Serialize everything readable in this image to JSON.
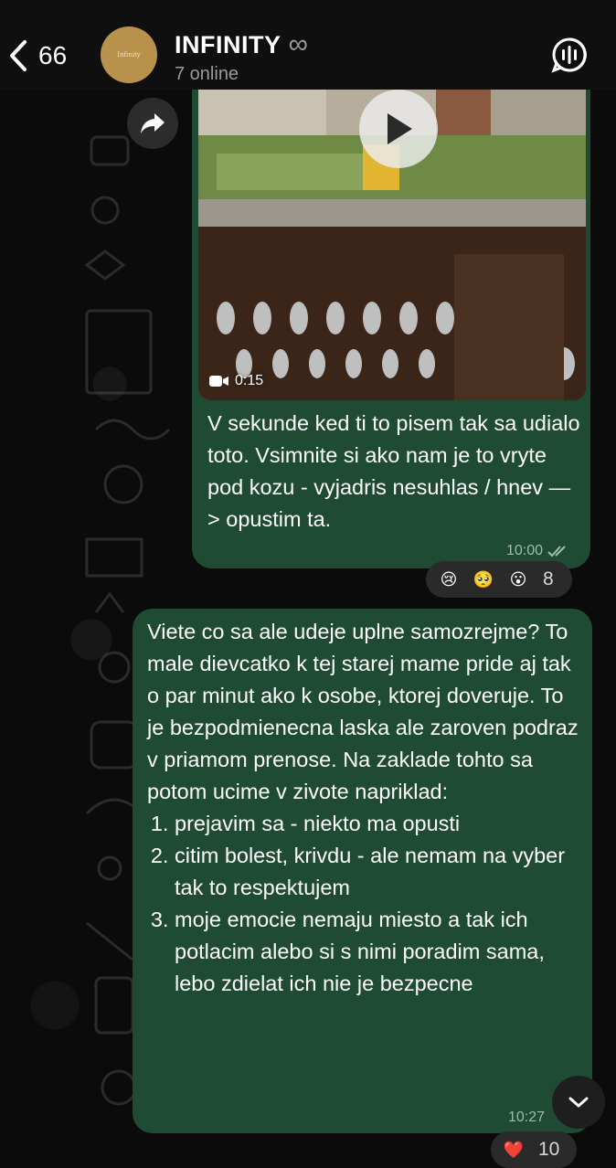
{
  "header": {
    "back_count": "66",
    "avatar_text": "Infinity",
    "title": "INFINITY",
    "title_symbol": "∞",
    "subtitle": "7 online",
    "call_icon": "voice-chat-icon"
  },
  "messages": [
    {
      "type": "video",
      "video_duration": "0:15",
      "text": "V sekunde ked ti to pisem tak sa udialo toto. Vsimnite si ako nam je to vryte pod kozu - vyjadris nesuhlas / hnev —> opustim ta.",
      "time": "10:00",
      "status": "read",
      "reactions": [
        "😢",
        "🥺",
        "😮"
      ],
      "reaction_count": "8"
    },
    {
      "type": "text",
      "intro": "Viete co sa ale udeje uplne samozrejme? To male dievcatko k tej starej mame pride aj tak o par minut ako k osobe, ktorej doveruje. To je bezpodmienecna laska ale zaroven podraz v priamom prenose. Na zaklade tohto sa potom ucime v zivote napriklad:",
      "items": [
        "prejavim sa - niekto ma opusti",
        "citim bolest, krivdu - ale nemam na vyber tak to respektujem",
        "moje emocie nemaju miesto a tak ich potlacim alebo si s nimi poradim sama, lebo zdielat ich nie je bezpecne"
      ],
      "time": "10:27",
      "reactions": [
        "❤️"
      ],
      "reaction_count": "10"
    }
  ],
  "colors": {
    "bubble": "#1f4a33",
    "background": "#0b0b0b",
    "header": "#0f0f0f"
  }
}
